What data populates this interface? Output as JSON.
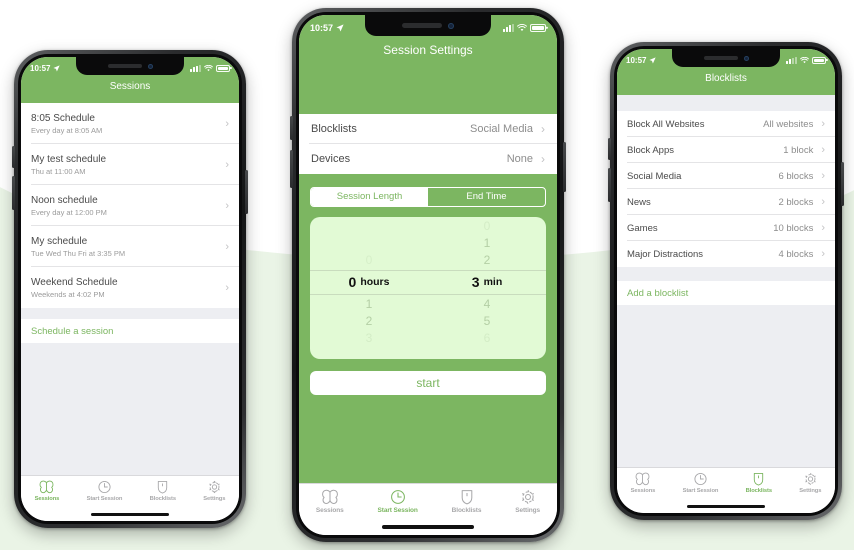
{
  "meta": {
    "app_accent": "#7cb661",
    "page_bg_top": "#ffffff",
    "page_bg_bottom": "#eaf4e6"
  },
  "status_bar": {
    "time": "10:57",
    "location_icon": "location-arrow-icon",
    "signal_icon": "cellular-signal-icon",
    "wifi_icon": "wifi-icon",
    "battery_icon": "battery-icon"
  },
  "tabs": [
    {
      "label": "Sessions",
      "icon": "butterfly-icon"
    },
    {
      "label": "Start Session",
      "icon": "clock-icon"
    },
    {
      "label": "Blocklists",
      "icon": "shield-icon"
    },
    {
      "label": "Settings",
      "icon": "gear-icon"
    }
  ],
  "phone_left": {
    "nav_title": "Sessions",
    "active_tab": "Sessions",
    "sessions": [
      {
        "title": "8:05 Schedule",
        "subtitle": "Every day at 8:05 AM"
      },
      {
        "title": "My test schedule",
        "subtitle": "Thu at 11:00 AM"
      },
      {
        "title": "Noon schedule",
        "subtitle": "Every day at 12:00 PM"
      },
      {
        "title": "My schedule",
        "subtitle": "Tue Wed Thu Fri at 3:35 PM"
      },
      {
        "title": "Weekend Schedule",
        "subtitle": "Weekends at 4:02 PM"
      }
    ],
    "add_action": "Schedule a session"
  },
  "phone_center": {
    "nav_title": "Session Settings",
    "active_tab": "Start Session",
    "settings_rows": [
      {
        "label": "Blocklists",
        "value": "Social Media"
      },
      {
        "label": "Devices",
        "value": "None"
      }
    ],
    "segmented": {
      "options": [
        "Session Length",
        "End Time"
      ],
      "selected": "Session Length"
    },
    "picker": {
      "hours": {
        "above": [
          "0"
        ],
        "selected": "0",
        "unit": "hours",
        "below": [
          "1",
          "2",
          "3"
        ]
      },
      "minutes": {
        "above": [
          "0",
          "1",
          "2"
        ],
        "selected": "3",
        "unit": "min",
        "below": [
          "4",
          "5",
          "6"
        ]
      }
    },
    "start_button": "start"
  },
  "phone_right": {
    "nav_title": "Blocklists",
    "active_tab": "Blocklists",
    "blocklists": [
      {
        "name": "Block All Websites",
        "count": "All websites"
      },
      {
        "name": "Block Apps",
        "count": "1 block"
      },
      {
        "name": "Social Media",
        "count": "6 blocks"
      },
      {
        "name": "News",
        "count": "2 blocks"
      },
      {
        "name": "Games",
        "count": "10 blocks"
      },
      {
        "name": "Major Distractions",
        "count": "4 blocks"
      }
    ],
    "add_action": "Add a blocklist"
  }
}
